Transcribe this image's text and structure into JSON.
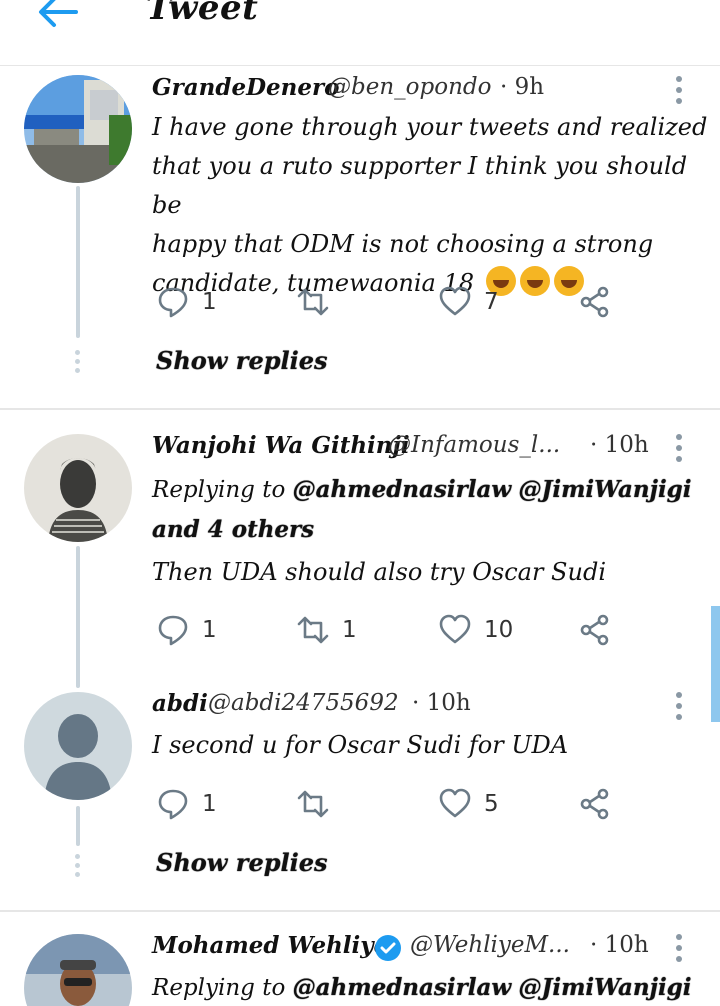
{
  "header": {
    "title": "Tweet"
  },
  "tweets": [
    {
      "name": "GrandeDenero",
      "handle": "@ben_opondo",
      "time": "· 9h",
      "text_lines": [
        "I have gone through your tweets and realized",
        "that you a ruto supporter I think you should be",
        "happy that ODM is not choosing a strong",
        "candidate, tumewaonia 18"
      ],
      "emoji": "rolling-on-floor-laughing",
      "replies": "1",
      "retweets": "",
      "likes": "7",
      "show_replies": "Show replies"
    },
    {
      "name": "Wanjohi Wa Githinji",
      "handle": "@Infamous_l...",
      "time": "· 10h",
      "replying_prefix": "Replying to",
      "mentions": [
        "@ahmednasirlaw",
        "@JimiWanjigi"
      ],
      "others": "and 4 others",
      "text": "Then UDA should also try Oscar Sudi",
      "replies": "1",
      "retweets": "1",
      "likes": "10"
    },
    {
      "name": "abdi",
      "handle": "@abdi24755692",
      "time": "· 10h",
      "text": "I second u for Oscar Sudi for UDA",
      "replies": "1",
      "retweets": "",
      "likes": "5",
      "show_replies": "Show replies"
    },
    {
      "name": "Mohamed Wehliye",
      "handle": "@WehliyeM...",
      "time": "· 10h",
      "replying_prefix": "Replying to",
      "mentions": [
        "@ahmednasirlaw",
        "@JimiWanjigi"
      ]
    }
  ],
  "colors": {
    "accent": "#1d9bf0",
    "icon": "#6b7a86",
    "verified": "#1d9bf0"
  }
}
